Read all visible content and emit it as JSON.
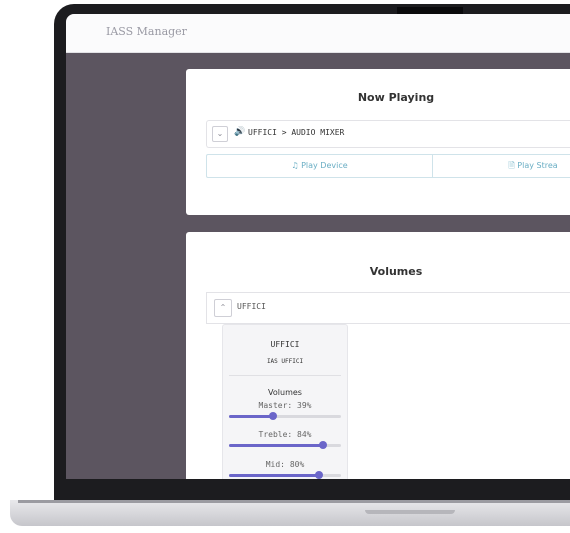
{
  "app": {
    "title": "IASS Manager"
  },
  "now_playing": {
    "title": "Now Playing",
    "source_path": "UFFICI > AUDIO MIXER",
    "play_device_label": "Play Device",
    "play_stream_label": "Play Strea",
    "accent_color": "#6aaec4"
  },
  "volumes": {
    "title": "Volumes",
    "group_label": "UFFICI",
    "device": {
      "name": "UFFICI",
      "subtitle": "IAS UFFICI",
      "heading": "Volumes",
      "sliders": [
        {
          "label": "Master: 39%",
          "value": 0.39
        },
        {
          "label": "Treble: 84%",
          "value": 0.84
        },
        {
          "label": "Mid: 80%",
          "value": 0.8
        }
      ],
      "slider_color": "#6b66c9"
    }
  },
  "icons": {
    "collapse": "chevron-down-icon",
    "expand": "chevron-up-icon",
    "speaker": "speaker-icon",
    "music": "music-note-icon",
    "document": "document-icon"
  }
}
